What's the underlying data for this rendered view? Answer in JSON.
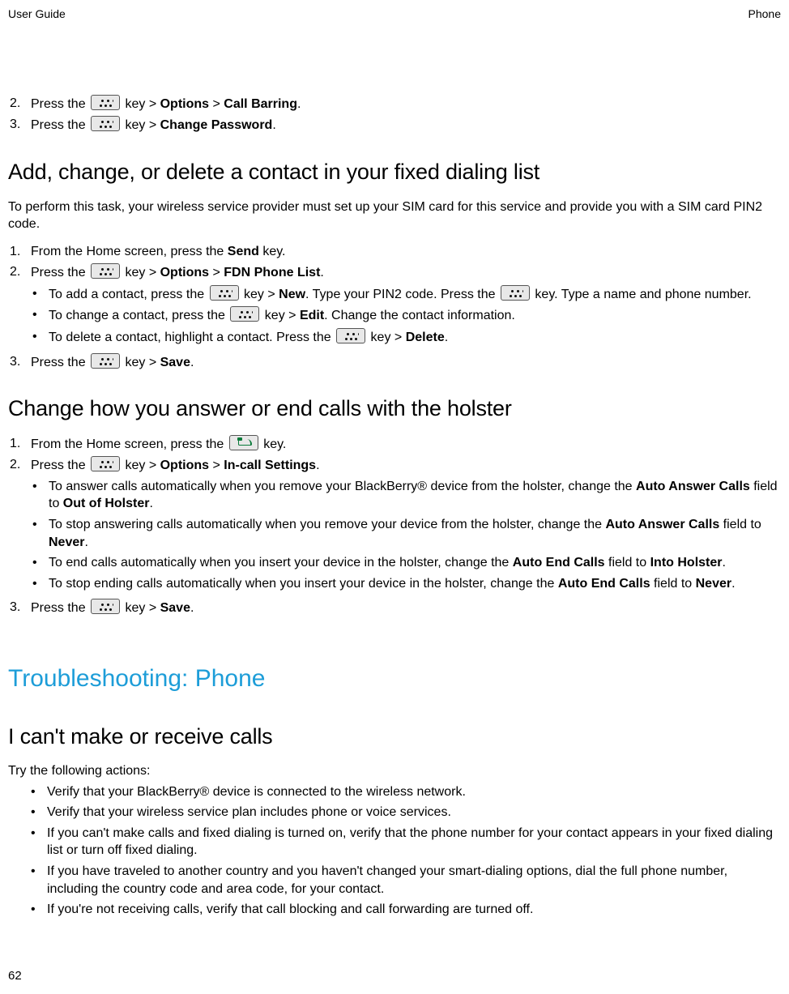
{
  "header": {
    "left": "User Guide",
    "right": "Phone"
  },
  "top_steps": {
    "s2": {
      "num": "2.",
      "pre": "Press the ",
      "post1": " key > ",
      "opt": "Options",
      "sep": " > ",
      "dest": "Call Barring",
      "end": "."
    },
    "s3": {
      "num": "3.",
      "pre": "Press the ",
      "post1": " key > ",
      "dest": "Change Password",
      "end": "."
    }
  },
  "sec1": {
    "title": "Add, change, or delete a contact in your fixed dialing list",
    "intro": "To perform this task, your wireless service provider must set up your SIM card for this service and provide you with a SIM card PIN2 code.",
    "s1": {
      "num": "1.",
      "pre": "From the Home screen, press the ",
      "key": "Send",
      "post": " key."
    },
    "s2": {
      "num": "2.",
      "pre": "Press the ",
      "post1": " key > ",
      "opt": "Options",
      "sep": " > ",
      "dest": "FDN Phone List",
      "end": "."
    },
    "b1": {
      "pre": "To add a contact, press the ",
      "mid1": " key > ",
      "act": "New",
      "mid2": ". Type your PIN2 code. Press the ",
      "mid3": " key. Type a name and phone number."
    },
    "b2": {
      "pre": "To change a contact, press the ",
      "mid1": " key > ",
      "act": "Edit",
      "post": ". Change the contact information."
    },
    "b3": {
      "pre": "To delete a contact, highlight a contact. Press the ",
      "mid1": " key > ",
      "act": "Delete",
      "end": "."
    },
    "s3": {
      "num": "3.",
      "pre": "Press the ",
      "post1": " key > ",
      "dest": "Save",
      "end": "."
    }
  },
  "sec2": {
    "title": "Change how you answer or end calls with the holster",
    "s1": {
      "num": "1.",
      "pre": "From the Home screen, press the ",
      "post": " key."
    },
    "s2": {
      "num": "2.",
      "pre": "Press the ",
      "post1": " key > ",
      "opt": "Options",
      "sep": " > ",
      "dest": "In-call Settings",
      "end": "."
    },
    "b1": {
      "t1": "To answer calls automatically when you remove your BlackBerry® device from the holster, change the ",
      "f1": "Auto Answer Calls",
      "t2": " field to ",
      "v1": "Out of Holster",
      "end": "."
    },
    "b2": {
      "t1": "To stop answering calls automatically when you remove your device from the holster, change the ",
      "f1": "Auto Answer Calls",
      "t2": " field to ",
      "v1": "Never",
      "end": "."
    },
    "b3": {
      "t1": "To end calls automatically when you insert your device in the holster, change the ",
      "f1": "Auto End Calls",
      "t2": " field to ",
      "v1": "Into Holster",
      "end": "."
    },
    "b4": {
      "t1": "To stop ending calls automatically when you insert your device in the holster, change the ",
      "f1": "Auto End Calls",
      "t2": " field to ",
      "v1": "Never",
      "end": "."
    },
    "s3": {
      "num": "3.",
      "pre": "Press the ",
      "post1": " key > ",
      "dest": "Save",
      "end": "."
    }
  },
  "chapter": {
    "title": "Troubleshooting: Phone"
  },
  "sec3": {
    "title": "I can't make or receive calls",
    "try": "Try the following actions:",
    "b1": "Verify that your BlackBerry® device is connected to the wireless network.",
    "b2": "Verify that your wireless service plan includes phone or voice services.",
    "b3": "If you can't make calls and fixed dialing is turned on, verify that the phone number for your contact appears in your fixed dialing list or turn off fixed dialing.",
    "b4": "If you have traveled to another country and you haven't changed your smart-dialing options, dial the full phone number, including the country code and area code, for your contact.",
    "b5": "If you're not receiving calls, verify that call blocking and call forwarding are turned off."
  },
  "page": "62",
  "bullet_char": "•"
}
